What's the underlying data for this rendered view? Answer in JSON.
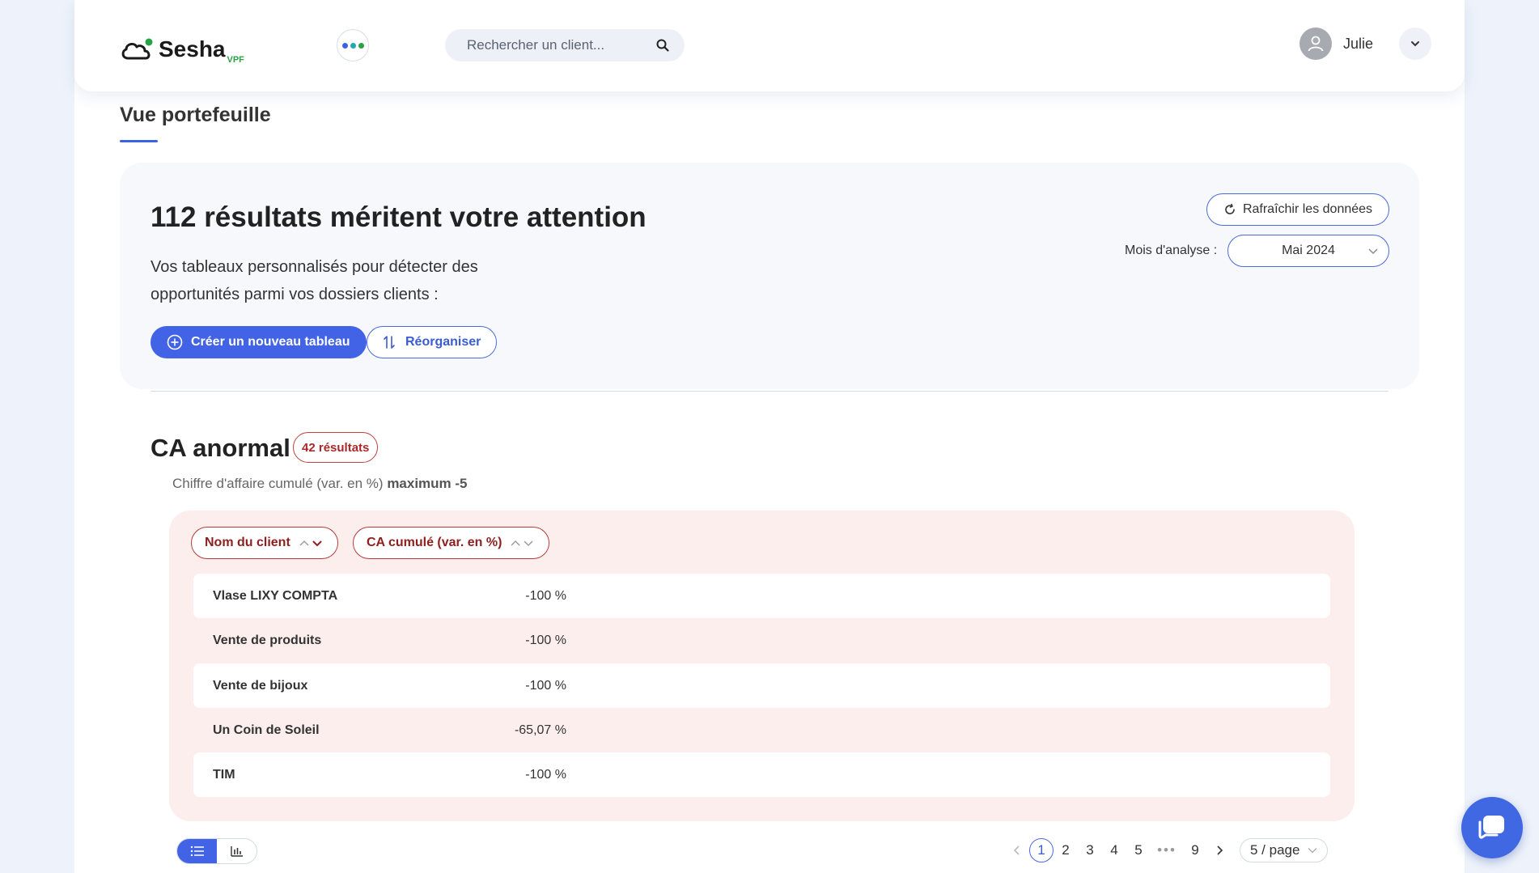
{
  "header": {
    "logo_text": "Sesha",
    "logo_sub": "VPF",
    "search_placeholder": "Rechercher un client...",
    "user_name": "Julie",
    "apps_dots_colors": [
      "#3b62e2",
      "#22a6b3",
      "#27a345"
    ]
  },
  "page": {
    "title": "Vue portefeuille"
  },
  "hero": {
    "title": "112 résultats méritent votre attention",
    "description": "Vos tableaux personnalisés pour détecter des opportunités parmi vos dossiers clients :",
    "create_button": "Créer un nouveau tableau",
    "reorganize_button": "Réorganiser",
    "refresh_button": "Rafraîchir les données",
    "month_label": "Mois d'analyse :",
    "month_value": "Mai 2024"
  },
  "section": {
    "title": "CA anormal",
    "badge": "42 résultats",
    "subtitle_prefix": "Chiffre d'affaire cumulé (var. en %)",
    "subtitle_bold": "maximum -5",
    "columns": [
      "Nom du client",
      "CA cumulé (var. en %)"
    ],
    "rows": [
      {
        "name": "Vlase LIXY COMPTA",
        "value": "-100 %"
      },
      {
        "name": "Vente de produits",
        "value": "-100 %"
      },
      {
        "name": "Vente de bijoux",
        "value": "-100 %"
      },
      {
        "name": "Un Coin de Soleil",
        "value": "-65,07 %"
      },
      {
        "name": "TIM",
        "value": "-100 %"
      }
    ]
  },
  "pagination": {
    "pages": [
      "1",
      "2",
      "3",
      "4",
      "5"
    ],
    "ellipsis": "•••",
    "last_page": "9",
    "current_page": "1",
    "page_size": "5 / page"
  },
  "colors": {
    "primary": "#4363e6",
    "danger": "#b83a3a",
    "table_bg": "#fdeeee"
  }
}
